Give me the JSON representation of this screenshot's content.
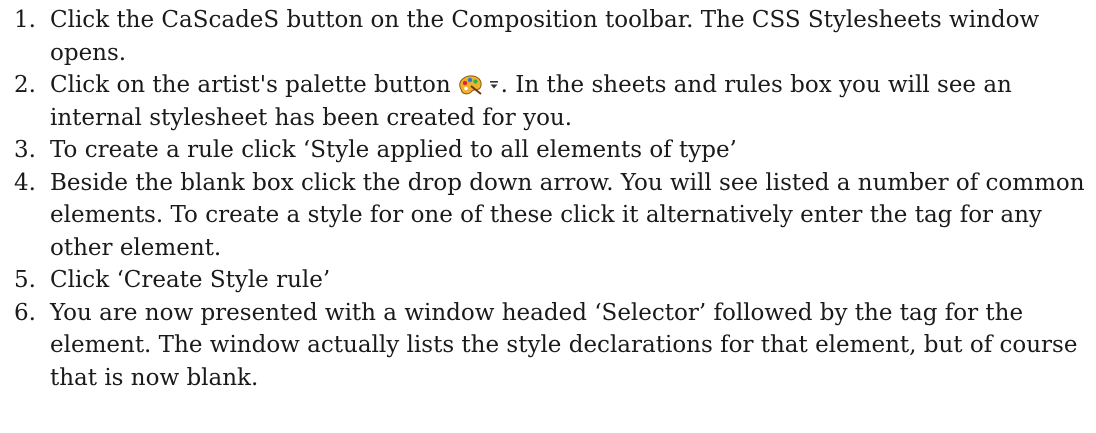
{
  "steps": [
    {
      "num": "1.",
      "text": "Click the CaScadeS button on the Composition toolbar. The CSS Stylesheets window opens."
    },
    {
      "num": "2.",
      "text_before": "Click on the artist's palette button",
      "text_after": ". In the sheets and rules box you will see an internal stylesheet has been created for you.",
      "icon": "artist-palette-icon"
    },
    {
      "num": "3.",
      "text": "To create a rule click ‘Style applied to all elements of type’"
    },
    {
      "num": "4.",
      "text": "Beside the blank box click the drop down arrow. You will see listed a number of common elements. To create a style for one of these click it alternatively enter the tag for any other element."
    },
    {
      "num": "5.",
      "text": "Click ‘Create Style rule’"
    },
    {
      "num": "6.",
      "text": "You are now presented with a window headed ‘Selector’ followed by the tag for the element. The window actually lists the style declarations for that element, but of course that is now blank."
    }
  ]
}
